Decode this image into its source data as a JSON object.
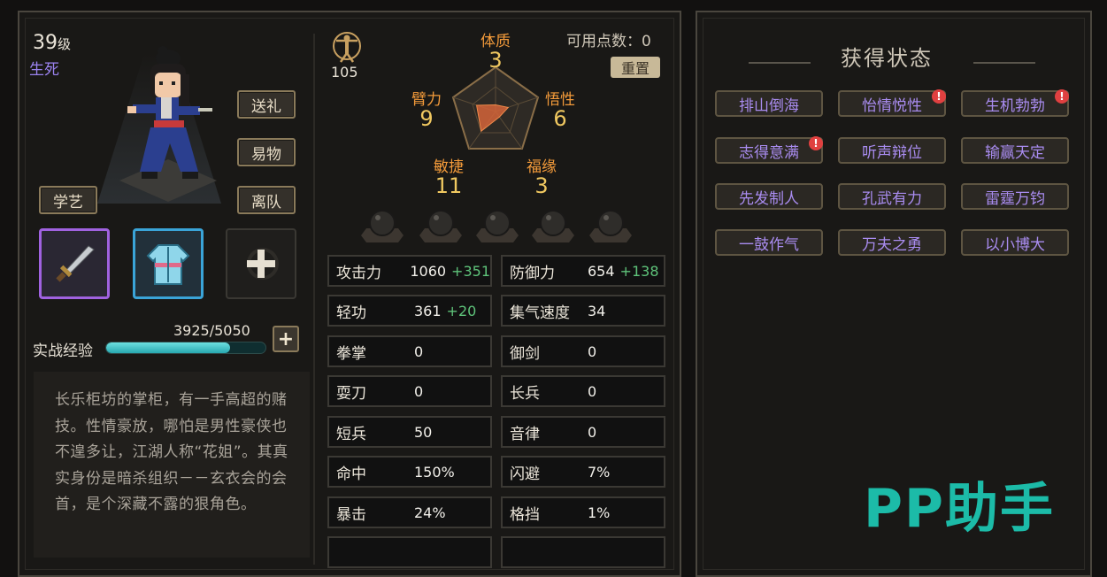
{
  "profile": {
    "level": "39",
    "level_unit": "级",
    "sect": "生死",
    "actions": {
      "gift": "送礼",
      "trade": "易物",
      "leave": "离队",
      "learn": "学艺"
    },
    "equipment": {
      "weapon": "dagger-icon",
      "armor": "robe-icon",
      "accessory": "add-icon"
    },
    "xp_label": "实战经验",
    "xp_value": "3925/5050",
    "xp_progress": 0.777,
    "bio": "长乐柜坊的掌柜，有一手高超的赌技。性情豪放，哪怕是男性豪侠也不遑多让，江湖人称“花姐”。其真实身份是暗杀组织－－玄衣会的会首，是个深藏不露的狠角色。"
  },
  "attributes": {
    "points_icon": "vitruvian-icon",
    "points": "105",
    "available_label": "可用点数：",
    "available_value": "0",
    "reset": "重置",
    "constitution": {
      "label": "体质",
      "value": "3"
    },
    "strength": {
      "label": "臂力",
      "value": "9"
    },
    "insight": {
      "label": "悟性",
      "value": "6"
    },
    "agility": {
      "label": "敏捷",
      "value": "11"
    },
    "fortune": {
      "label": "福缘",
      "value": "3"
    }
  },
  "stats": {
    "attack": {
      "label": "攻击力",
      "value": "1060",
      "bonus": "+351"
    },
    "defense": {
      "label": "防御力",
      "value": "654",
      "bonus": "+138"
    },
    "lightness": {
      "label": "轻功",
      "value": "361",
      "bonus": "+20"
    },
    "qi_speed": {
      "label": "集气速度",
      "value": "34"
    },
    "fist": {
      "label": "拳掌",
      "value": "0"
    },
    "sword": {
      "label": "御剑",
      "value": "0"
    },
    "blade": {
      "label": "耍刀",
      "value": "0"
    },
    "polearm": {
      "label": "长兵",
      "value": "0"
    },
    "short": {
      "label": "短兵",
      "value": "50"
    },
    "music": {
      "label": "音律",
      "value": "0"
    },
    "hit": {
      "label": "命中",
      "value": "150%"
    },
    "dodge": {
      "label": "闪避",
      "value": "7%"
    },
    "crit": {
      "label": "暴击",
      "value": "24%"
    },
    "block": {
      "label": "格挡",
      "value": "1%"
    }
  },
  "status": {
    "title": "获得状态",
    "tags": [
      "排山倒海",
      "怡情悦性",
      "生机勃勃",
      "志得意满",
      "听声辩位",
      "输赢天定",
      "先发制人",
      "孔武有力",
      "雷霆万钧",
      "一鼓作气",
      "万夫之勇",
      "以小博大"
    ],
    "alert_mark": "!"
  },
  "watermark": "PP助手"
}
